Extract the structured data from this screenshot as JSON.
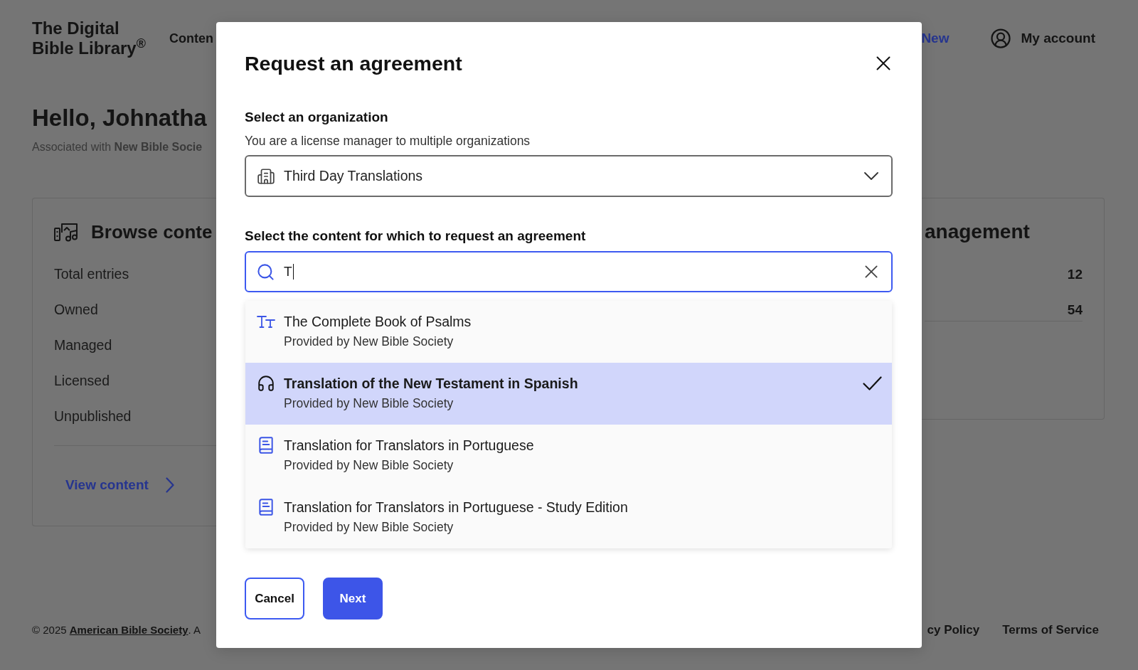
{
  "header": {
    "logo": "The Digital Bible Library$^{®}$",
    "menu": [
      "Conten"
    ],
    "action_link": "New",
    "account": "My account"
  },
  "greeting": {
    "title": "Hello, Johnatha",
    "subtitle": "Associated with **New Bible Socie**"
  },
  "content_card": {
    "title": "Browse conte",
    "rows": [
      "Total entries",
      "Owned",
      "Managed",
      "Licensed",
      "Unpublished"
    ],
    "link": "View content"
  },
  "management_card": {
    "title": "anagement",
    "values": [
      "12",
      "54"
    ]
  },
  "footer": {
    "copyright": "© 2025",
    "publisher": "American Bible Society",
    "after": ". A",
    "links": [
      "cy Policy",
      "Terms of Service"
    ]
  },
  "dialog": {
    "title": "Request an agreement",
    "organization": {
      "label": "Select an organization",
      "help": "You are a license manager to multiple organizations",
      "value": "Third Day Translations"
    },
    "content": {
      "label": "Select the content for which to request an agreement",
      "search": {
        "value": "T"
      },
      "results": [
        {
          "title": "The Complete Book of Psalms",
          "provider": "Provided by New Bible Society",
          "kind": "text",
          "selected": false
        },
        {
          "title": "Translation of the New Testament in Spanish",
          "provider": "Provided by New Bible Society",
          "kind": "audio",
          "selected": true
        },
        {
          "title": "Translation for Translators in Portuguese",
          "provider": "Provided by New Bible Society",
          "kind": "book",
          "selected": false
        },
        {
          "title": "Translation for Translators in Portuguese - Study Edition",
          "provider": "Provided by New Bible Society",
          "kind": "book",
          "selected": false
        }
      ]
    },
    "buttons": [
      {
        "label": "Cancel",
        "kind": "secondary"
      },
      {
        "label": "Next",
        "kind": "primary"
      }
    ]
  }
}
